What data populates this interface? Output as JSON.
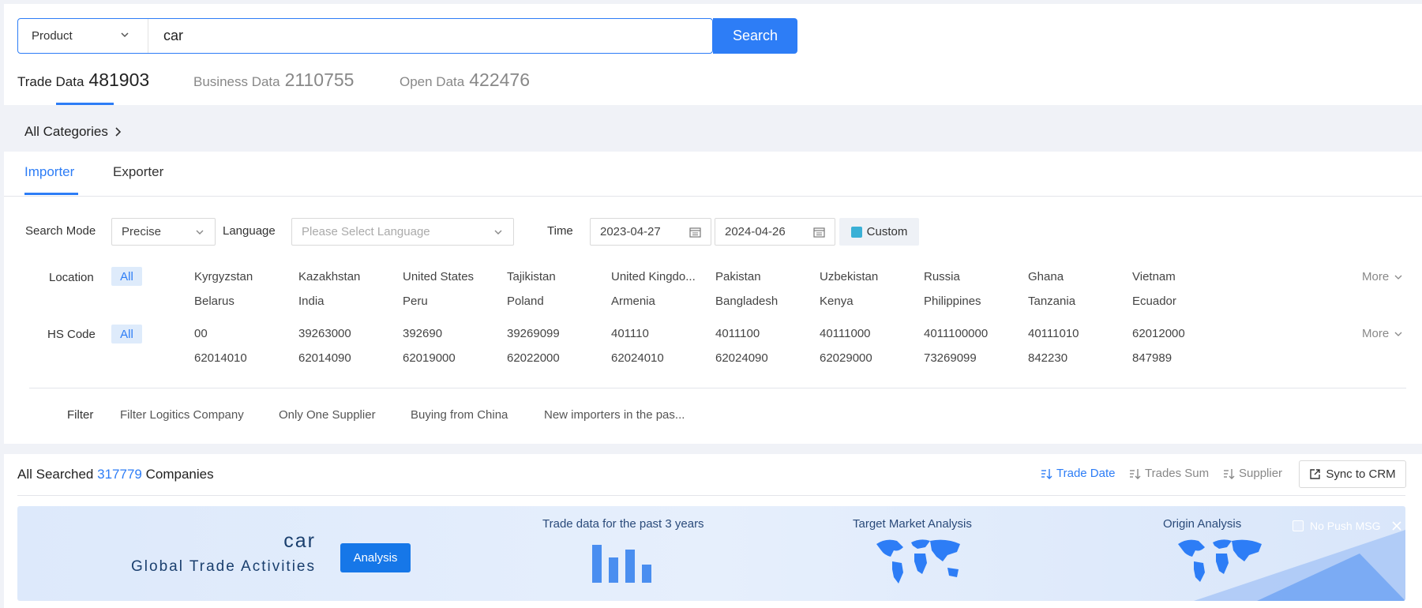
{
  "search": {
    "type_label": "Product",
    "query": "car",
    "button_label": "Search"
  },
  "data_tabs": [
    {
      "label": "Trade Data",
      "count": "481903"
    },
    {
      "label": "Business Data",
      "count": "2110755"
    },
    {
      "label": "Open Data",
      "count": "422476"
    }
  ],
  "categories_label": "All Categories",
  "role_tabs": [
    "Importer",
    "Exporter"
  ],
  "filters": {
    "search_mode_label": "Search Mode",
    "search_mode_value": "Precise",
    "language_label": "Language",
    "language_placeholder": "Please Select Language",
    "time_label": "Time",
    "date_start": "2023-04-27",
    "date_end": "2024-04-26",
    "custom_label": "Custom",
    "location_label": "Location",
    "hs_label": "HS Code",
    "all_label": "All",
    "more_label": "More",
    "locations": [
      "Kyrgyzstan",
      "Kazakhstan",
      "United States",
      "Tajikistan",
      "United Kingdo...",
      "Pakistan",
      "Uzbekistan",
      "Russia",
      "Ghana",
      "Vietnam",
      "Belarus",
      "India",
      "Peru",
      "Poland",
      "Armenia",
      "Bangladesh",
      "Kenya",
      "Philippines",
      "Tanzania",
      "Ecuador"
    ],
    "hs_codes": [
      "00",
      "39263000",
      "392690",
      "39269099",
      "401110",
      "4011100",
      "40111000",
      "4011100000",
      "40111010",
      "62012000",
      "62014010",
      "62014090",
      "62019000",
      "62022000",
      "62024010",
      "62024090",
      "62029000",
      "73269099",
      "842230",
      "847989"
    ],
    "filter_label": "Filter",
    "filter_options": [
      "Filter Logitics Company",
      "Only One Supplier",
      "Buying from China",
      "New importers in the pas..."
    ]
  },
  "results": {
    "prefix": "All Searched",
    "count": "317779",
    "suffix": "Companies",
    "sort_options": [
      "Trade Date",
      "Trades Sum",
      "Supplier"
    ],
    "sync_label": "Sync to CRM"
  },
  "banner": {
    "word": "car",
    "subtitle": "Global Trade Activities",
    "analysis_label": "Analysis",
    "trade_heading": "Trade data for the past 3 years",
    "market_heading": "Target Market Analysis",
    "origin_heading": "Origin Analysis",
    "no_push_label": "No Push MSG"
  },
  "colors": {
    "accent": "#2d7df6",
    "background": "#f0f2f7"
  }
}
